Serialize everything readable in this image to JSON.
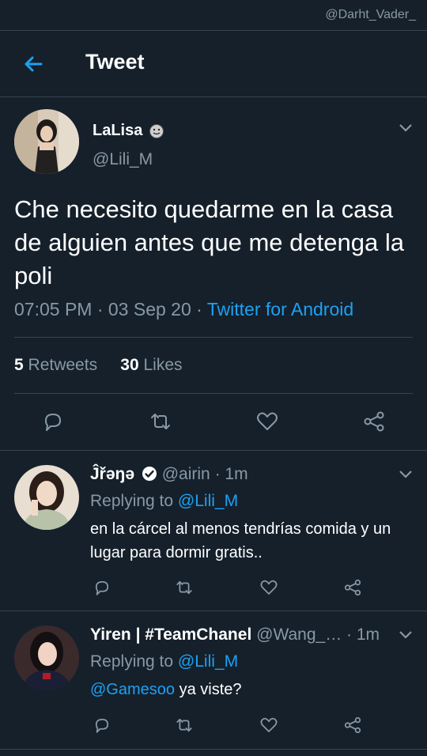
{
  "watermark": "@Darht_Vader_",
  "header": {
    "title": "Tweet"
  },
  "tweet": {
    "name": "LaLisa",
    "handle": "@Lili_M",
    "text": "Che necesito quedarme en la casa de alguien antes que me detenga la poli",
    "time": "07:05 PM · 03 Sep 20 · ",
    "source": "Twitter for Android",
    "retweets_count": "5",
    "retweets_label": "Retweets",
    "likes_count": "30",
    "likes_label": "Likes"
  },
  "replies": [
    {
      "name": "Ĵřəŋə",
      "handle": "@airin · 1m",
      "replying_prefix": "Replying to ",
      "replying_to": "@Lili_M",
      "text": "en la cárcel al menos tendrías comida y un lugar para dormir gratis.."
    },
    {
      "name": "Yiren | #TeamChanel",
      "handle": "@Wang_… · 1m",
      "replying_prefix": "Replying to ",
      "replying_to": "@Lili_M",
      "mention": "@Gamesoo",
      "text": " ya viste?"
    }
  ],
  "colors": {
    "background": "#15202b",
    "accent": "#1da1f2",
    "secondary_text": "#8899a6",
    "divider": "#38444d"
  },
  "icons": [
    "back-arrow-icon",
    "smiley-icon",
    "chevron-down-icon",
    "reply-icon",
    "retweet-icon",
    "like-icon",
    "share-icon",
    "verified-icon"
  ]
}
